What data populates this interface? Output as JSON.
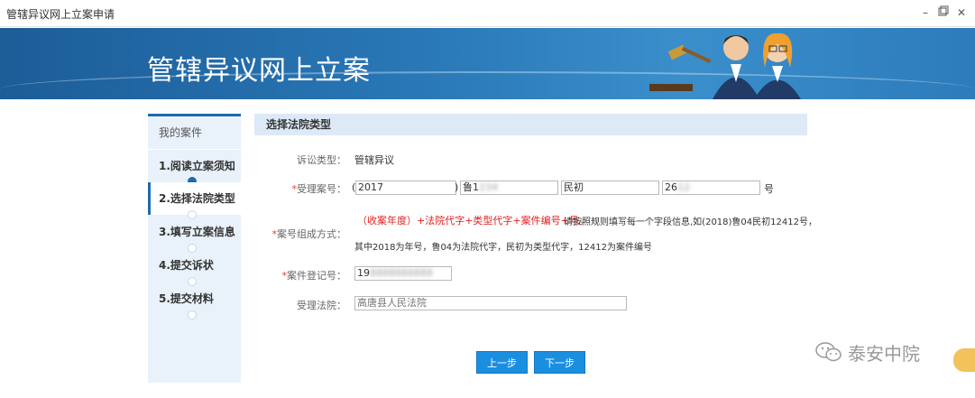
{
  "window": {
    "title": "管辖异议网上立案申请"
  },
  "banner": {
    "title": "管辖异议网上立案"
  },
  "sidebar": {
    "header": "我的案件",
    "steps": [
      {
        "label": "1.阅读立案须知",
        "status": "done"
      },
      {
        "label": "2.选择法院类型",
        "status": "active"
      },
      {
        "label": "3.填写立案信息",
        "status": "pending"
      },
      {
        "label": "4.提交诉状",
        "status": "pending"
      },
      {
        "label": "5.提交材料",
        "status": "pending"
      }
    ]
  },
  "section": {
    "title": "选择法院类型"
  },
  "form": {
    "case_type_label": "诉讼类型：",
    "case_type_value": "管辖异议",
    "case_no_label": "受理案号：",
    "case_no": {
      "open": "(",
      "year": "2017",
      "close": ")",
      "court_code": "鲁1",
      "type_code": "民初",
      "serial": "26",
      "suffix": "号"
    },
    "composition_label": "案号组成方式：",
    "composition_red": "（收案年度）+法院代字+类型代字+案件编号+号。",
    "composition_tail": "请按照规则填写每一个字段信息,如(2018)鲁04民初12412号，",
    "composition_line2": "其中2018为年号，鲁04为法院代字，民初为类型代字，12412为案件编号",
    "reg_no_label": "案件登记号：",
    "reg_no_value": "19",
    "court_label": "受理法院：",
    "court_placeholder": "高唐县人民法院"
  },
  "buttons": {
    "prev": "上一步",
    "next": "下一步"
  },
  "watermark": {
    "text": "泰安中院"
  },
  "colors": {
    "accent": "#1c6bb0",
    "button": "#1a8fe0",
    "required": "#e03b3b"
  }
}
